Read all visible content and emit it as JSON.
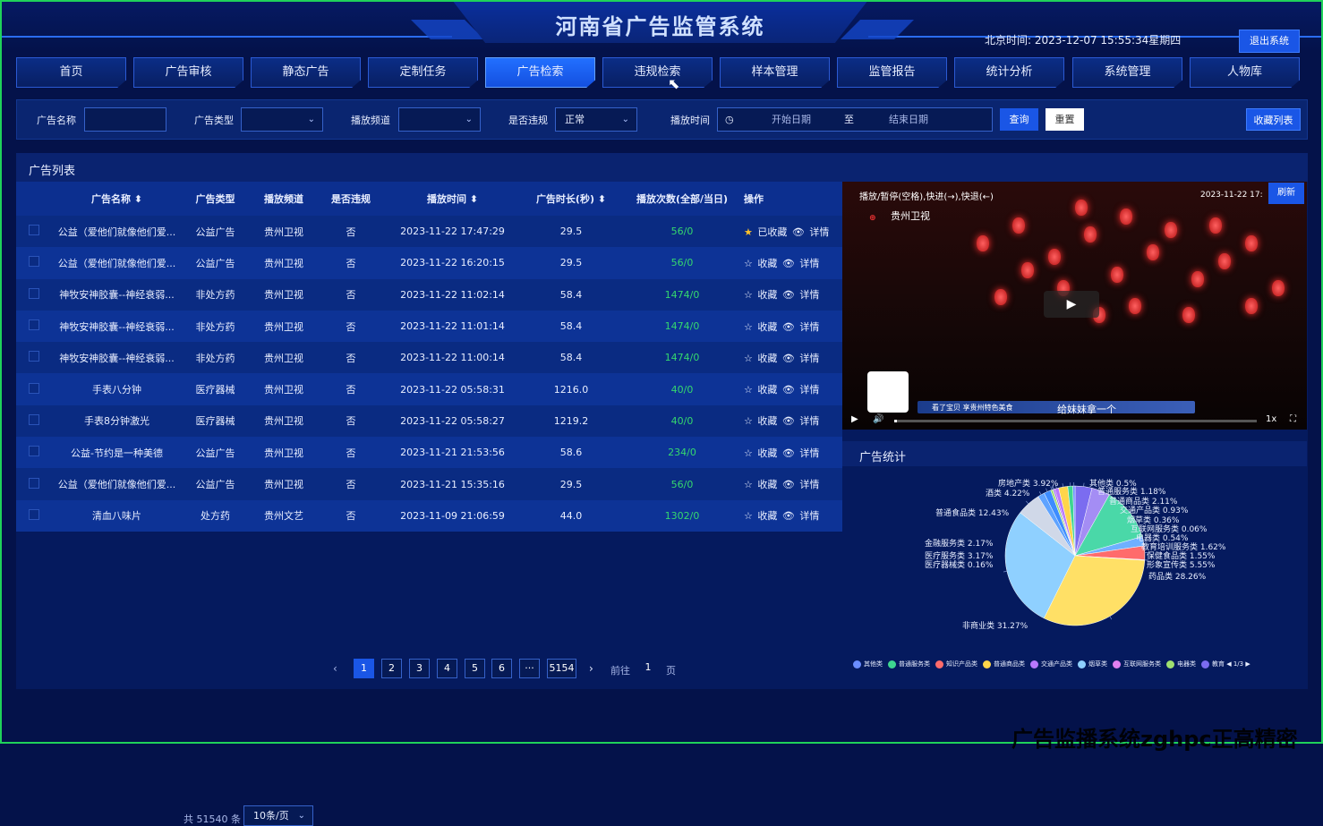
{
  "header": {
    "title": "河南省广告监管系统",
    "clock": "北京时间:  2023-12-07 15:55:34星期四",
    "logout_label": "退出系统"
  },
  "nav": [
    "首页",
    "广告审核",
    "静态广告",
    "定制任务",
    "广告检索",
    "违规检索",
    "样本管理",
    "监管报告",
    "统计分析",
    "系统管理",
    "人物库"
  ],
  "filter": {
    "name_label": "广告名称",
    "type_label": "广告类型",
    "channel_label": "播放频道",
    "violation_label": "是否违规",
    "violation_value": "正常",
    "time_label": "播放时间",
    "start_placeholder": "开始日期",
    "to_label": "至",
    "end_placeholder": "结束日期",
    "query_label": "查询",
    "reset_label": "重置",
    "fav_list_label": "收藏列表"
  },
  "list": {
    "title": "广告列表",
    "columns": [
      "广告名称",
      "广告类型",
      "播放频道",
      "是否违规",
      "播放时间",
      "广告时长(秒)",
      "播放次数(全部/当日)",
      "操作"
    ],
    "rows": [
      {
        "name": "公益（爱他们就像他们爱...",
        "type": "公益广告",
        "channel": "贵州卫视",
        "violation": "否",
        "time": "2023-11-22 17:47:29",
        "duration": "29.5",
        "plays": "56/0",
        "fav": "已收藏",
        "detail": "详情",
        "faved": true
      },
      {
        "name": "公益（爱他们就像他们爱...",
        "type": "公益广告",
        "channel": "贵州卫视",
        "violation": "否",
        "time": "2023-11-22 16:20:15",
        "duration": "29.5",
        "plays": "56/0",
        "fav": "收藏",
        "detail": "详情",
        "faved": false
      },
      {
        "name": "神牧安神胶囊--神经衰弱...",
        "type": "非处方药",
        "channel": "贵州卫视",
        "violation": "否",
        "time": "2023-11-22 11:02:14",
        "duration": "58.4",
        "plays": "1474/0",
        "fav": "收藏",
        "detail": "详情",
        "faved": false
      },
      {
        "name": "神牧安神胶囊--神经衰弱...",
        "type": "非处方药",
        "channel": "贵州卫视",
        "violation": "否",
        "time": "2023-11-22 11:01:14",
        "duration": "58.4",
        "plays": "1474/0",
        "fav": "收藏",
        "detail": "详情",
        "faved": false
      },
      {
        "name": "神牧安神胶囊--神经衰弱...",
        "type": "非处方药",
        "channel": "贵州卫视",
        "violation": "否",
        "time": "2023-11-22 11:00:14",
        "duration": "58.4",
        "plays": "1474/0",
        "fav": "收藏",
        "detail": "详情",
        "faved": false
      },
      {
        "name": "手表八分钟",
        "type": "医疗器械",
        "channel": "贵州卫视",
        "violation": "否",
        "time": "2023-11-22 05:58:31",
        "duration": "1216.0",
        "plays": "40/0",
        "fav": "收藏",
        "detail": "详情",
        "faved": false
      },
      {
        "name": "手表8分钟激光",
        "type": "医疗器械",
        "channel": "贵州卫视",
        "violation": "否",
        "time": "2023-11-22 05:58:27",
        "duration": "1219.2",
        "plays": "40/0",
        "fav": "收藏",
        "detail": "详情",
        "faved": false
      },
      {
        "name": "公益-节约是一种美德",
        "type": "公益广告",
        "channel": "贵州卫视",
        "violation": "否",
        "time": "2023-11-21 21:53:56",
        "duration": "58.6",
        "plays": "234/0",
        "fav": "收藏",
        "detail": "详情",
        "faved": false
      },
      {
        "name": "公益（爱他们就像他们爱...",
        "type": "公益广告",
        "channel": "贵州卫视",
        "violation": "否",
        "time": "2023-11-21 15:35:16",
        "duration": "29.5",
        "plays": "56/0",
        "fav": "收藏",
        "detail": "详情",
        "faved": false
      },
      {
        "name": "清血八味片",
        "type": "处方药",
        "channel": "贵州文艺",
        "violation": "否",
        "time": "2023-11-09 21:06:59",
        "duration": "44.0",
        "plays": "1302/0",
        "fav": "收藏",
        "detail": "详情",
        "faved": false
      }
    ]
  },
  "pager": {
    "total": "共 51540 条",
    "page_size": "10条/页",
    "pages": [
      "1",
      "2",
      "3",
      "4",
      "5",
      "6",
      "···",
      "5154"
    ],
    "goto_label": "前往",
    "goto_value": "1",
    "page_suffix": "页"
  },
  "video": {
    "hint": "播放/暂停(空格),快进(→),快退(←)",
    "channel": "贵州卫视",
    "timestamp": "2023-11-22 17:",
    "caption": "看了宝贝  享贵州特色美食",
    "subtitle": "给妹妹拿一个",
    "speed": "1x",
    "refresh_label": "刷新"
  },
  "stats": {
    "title": "广告统计",
    "legend_page": "1/3"
  },
  "chart_data": {
    "type": "pie",
    "slices": [
      {
        "name": "房地产类",
        "value": 3.92,
        "color": "#7b6cf0"
      },
      {
        "name": "酒类",
        "value": 4.22,
        "color": "#a48df4"
      },
      {
        "name": "普通食品类",
        "value": 12.43,
        "color": "#4ad8a8"
      },
      {
        "name": "金融服务类",
        "value": 2.17,
        "color": "#6fb0ff"
      },
      {
        "name": "医疗服务类",
        "value": 3.17,
        "color": "#ff6b6b"
      },
      {
        "name": "医疗器械类",
        "value": 0.16,
        "color": "#f5a0c0"
      },
      {
        "name": "非商业类",
        "value": 31.27,
        "color": "#ffe066"
      },
      {
        "name": "药品类",
        "value": 28.26,
        "color": "#8fd0ff"
      },
      {
        "name": "形象宣传类",
        "value": 5.55,
        "color": "#d0d8e8"
      },
      {
        "name": "保健食品类",
        "value": 1.55,
        "color": "#5fa3ff"
      },
      {
        "name": "教育培训服务类",
        "value": 1.62,
        "color": "#3c8cff"
      },
      {
        "name": "电器类",
        "value": 0.54,
        "color": "#a0e070"
      },
      {
        "name": "互联网服务类",
        "value": 0.06,
        "color": "#e080f0"
      },
      {
        "name": "烟草类",
        "value": 0.36,
        "color": "#9c5cf0"
      },
      {
        "name": "交通产品类",
        "value": 0.93,
        "color": "#b878ff"
      },
      {
        "name": "普通商品类",
        "value": 2.11,
        "color": "#ffd54a"
      },
      {
        "name": "普通服务类",
        "value": 1.18,
        "color": "#3ed690"
      },
      {
        "name": "其他类",
        "value": 0.5,
        "color": "#6a8dff"
      }
    ],
    "legend": [
      {
        "name": "其他类",
        "color": "#6a8dff"
      },
      {
        "name": "普通服务类",
        "color": "#3ed690"
      },
      {
        "name": "知识产品类",
        "color": "#ff6b6b"
      },
      {
        "name": "普通商品类",
        "color": "#ffd54a"
      },
      {
        "name": "交通产品类",
        "color": "#b878ff"
      },
      {
        "name": "烟草类",
        "color": "#8fd0ff"
      },
      {
        "name": "互联网服务类",
        "color": "#e080f0"
      },
      {
        "name": "电器类",
        "color": "#a0e070"
      },
      {
        "name": "教育",
        "color": "#7b6cf0"
      }
    ]
  },
  "watermark": "广告监播系统zghpc正高精密"
}
